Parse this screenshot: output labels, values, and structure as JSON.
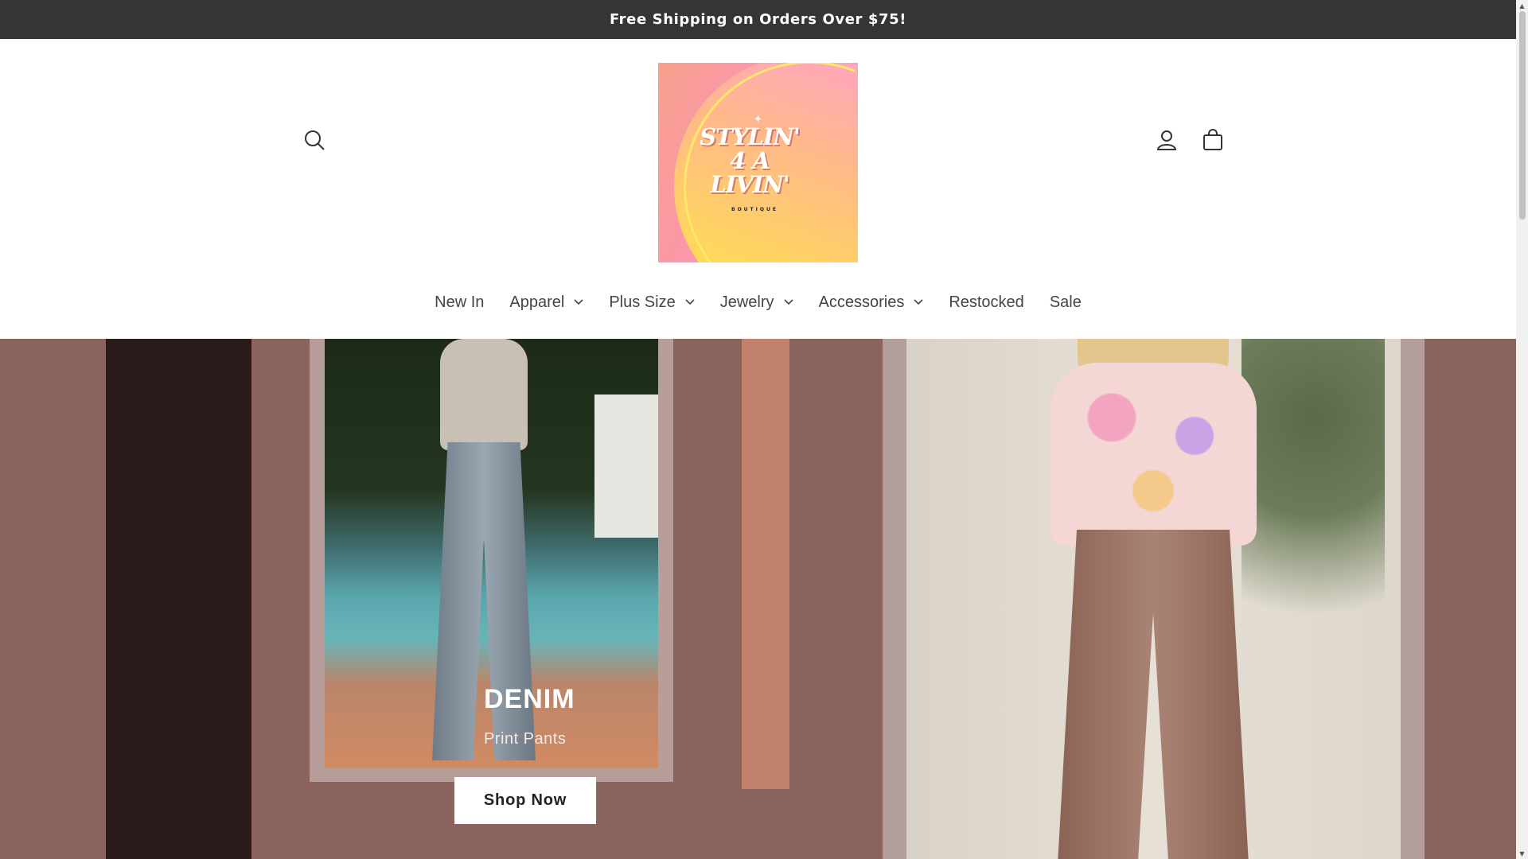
{
  "announcement": {
    "text": "Free Shipping on Orders Over $75!"
  },
  "header": {
    "logo": {
      "line1": "STYLIN'",
      "line2": "4 A",
      "line3": "LIVIN'",
      "tagline": "BOUTIQUE"
    },
    "icons": {
      "search": "search-icon",
      "account": "account-icon",
      "cart": "cart-icon"
    }
  },
  "nav": {
    "items": [
      {
        "label": "New In",
        "dropdown": false
      },
      {
        "label": "Apparel",
        "dropdown": true
      },
      {
        "label": "Plus Size",
        "dropdown": true
      },
      {
        "label": "Jewelry",
        "dropdown": true
      },
      {
        "label": "Accessories",
        "dropdown": true
      },
      {
        "label": "Restocked",
        "dropdown": false
      },
      {
        "label": "Sale",
        "dropdown": false
      }
    ]
  },
  "hero": {
    "heading": "DENIM",
    "subheading": "Print Pants",
    "button_label": "Shop Now",
    "colors": {
      "background": "#8b655d",
      "dark_stripe": "#2b1a1a",
      "rose_stripe": "#c3826e",
      "frame": "#b79e9a"
    }
  }
}
